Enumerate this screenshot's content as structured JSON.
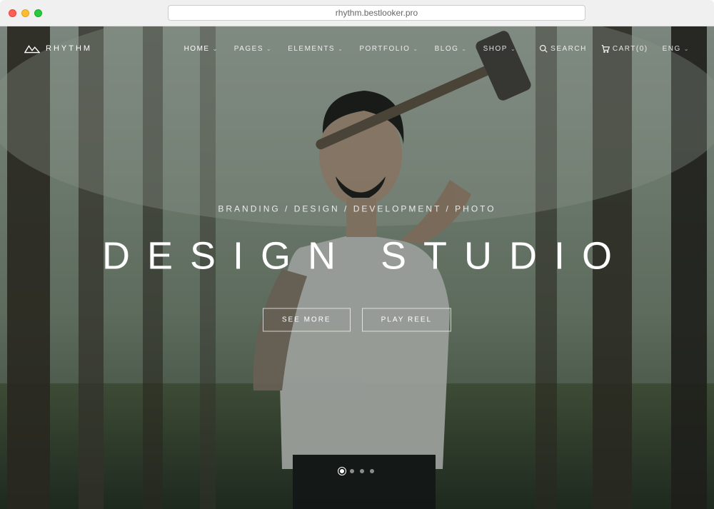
{
  "browser": {
    "url": "rhythm.bestlooker.pro"
  },
  "brand": {
    "name": "RHYTHM"
  },
  "nav": {
    "items": [
      {
        "label": "HOME"
      },
      {
        "label": "PAGES"
      },
      {
        "label": "ELEMENTS"
      },
      {
        "label": "PORTFOLIO"
      },
      {
        "label": "BLOG"
      },
      {
        "label": "SHOP"
      }
    ],
    "search": "SEARCH",
    "cart": "CART(0)",
    "lang": "ENG"
  },
  "hero": {
    "tagline": "BRANDING / DESIGN / DEVELOPMENT / PHOTO",
    "title": "DESIGN STUDIO",
    "btn1": "SEE MORE",
    "btn2": "PLAY REEL"
  },
  "slider": {
    "count": 4,
    "active": 0
  }
}
